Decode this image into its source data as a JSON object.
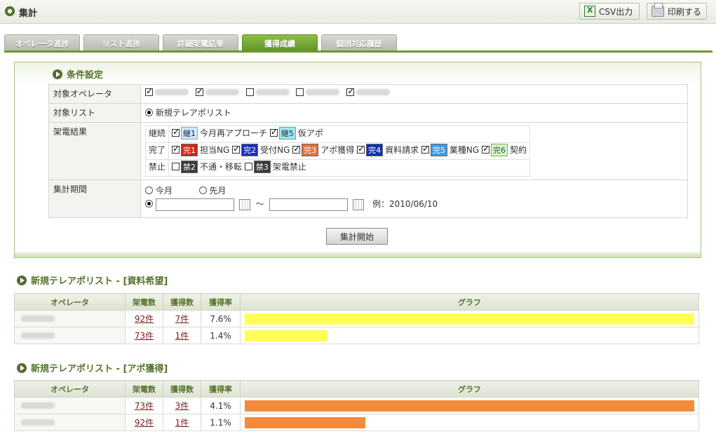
{
  "header": {
    "title": "集計",
    "csv_label": "CSV出力",
    "print_label": "印刷する"
  },
  "tabs": [
    {
      "label": "オペレータ進捗",
      "active": false
    },
    {
      "label": "リスト進捗",
      "active": false
    },
    {
      "label": "詳細架電結果",
      "active": false
    },
    {
      "label": "獲得成績",
      "active": true
    },
    {
      "label": "個別対応履歴",
      "active": false
    }
  ],
  "conditions": {
    "title": "条件設定",
    "rows": {
      "operators_label": "対象オペレータ",
      "list_label": "対象リスト",
      "result_label": "架電結果",
      "period_label": "集計期間"
    },
    "operators": [
      {
        "checked": true
      },
      {
        "checked": true
      },
      {
        "checked": false
      },
      {
        "checked": false
      },
      {
        "checked": true
      }
    ],
    "list_option": "新規テレアポリスト",
    "results": {
      "keizoku": {
        "label": "継続",
        "items": [
          {
            "badge": "継1",
            "text": "今月再アプローチ",
            "checked": true
          },
          {
            "badge": "継5",
            "text": "仮アポ",
            "checked": true
          }
        ]
      },
      "kanryo": {
        "label": "完了",
        "items": [
          {
            "badge": "完1",
            "text": "担当NG",
            "checked": true
          },
          {
            "badge": "完2",
            "text": "受付NG",
            "checked": true
          },
          {
            "badge": "完3",
            "text": "アポ獲得",
            "checked": true
          },
          {
            "badge": "完4",
            "text": "資料請求",
            "checked": true
          },
          {
            "badge": "完5",
            "text": "業種NG",
            "checked": true
          },
          {
            "badge": "完6",
            "text": "契約",
            "checked": true
          }
        ]
      },
      "kinshi": {
        "label": "禁止",
        "items": [
          {
            "badge": "禁2",
            "text": "不通・移転",
            "checked": false
          },
          {
            "badge": "禁3",
            "text": "架電禁止",
            "checked": false
          }
        ]
      }
    },
    "period": {
      "this_month": "今月",
      "last_month": "先月",
      "range_sep": "～",
      "example": "例：2010/06/10"
    },
    "submit_label": "集計開始"
  },
  "tables": [
    {
      "title": "新規テレアポリスト - [資料希望]",
      "headers": [
        "オペレータ",
        "架電数",
        "獲得数",
        "獲得率",
        "グラフ"
      ],
      "rows": [
        {
          "calls": "92件",
          "gained": "7件",
          "rate": "7.6%",
          "rate_value": 7.6
        },
        {
          "calls": "73件",
          "gained": "1件",
          "rate": "1.4%",
          "rate_value": 1.4
        }
      ],
      "bar_color": "#ffff55"
    },
    {
      "title": "新規テレアポリスト - [アポ獲得]",
      "headers": [
        "オペレータ",
        "架電数",
        "獲得数",
        "獲得率",
        "グラフ"
      ],
      "rows": [
        {
          "calls": "73件",
          "gained": "3件",
          "rate": "4.1%",
          "rate_value": 4.1
        },
        {
          "calls": "92件",
          "gained": "1件",
          "rate": "1.1%",
          "rate_value": 1.1
        }
      ],
      "bar_color": "#f58a3c"
    }
  ]
}
